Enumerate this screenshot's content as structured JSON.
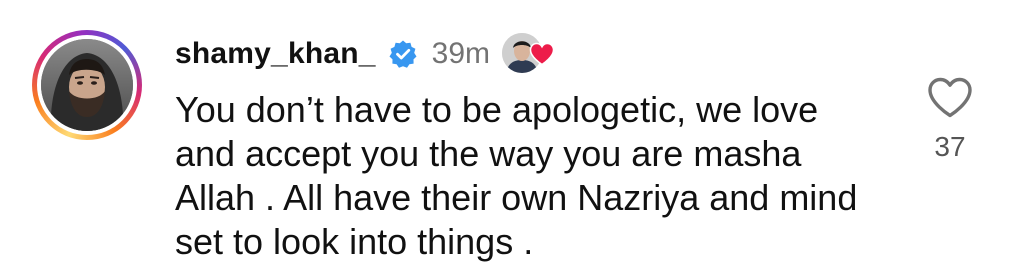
{
  "comment": {
    "username": "shamy_khan_",
    "verified": true,
    "timestamp": "39m",
    "text": "You don’t have to be apologetic, we love and accept you the way you are masha Allah . All have their own Nazriya and mind set to look into things .",
    "like_count": "37",
    "liked_by_author": true
  },
  "icons": {
    "verified": "verified-badge-icon",
    "like": "heart-outline-icon",
    "author_like": "heart-filled-icon"
  },
  "colors": {
    "verified_blue": "#3897f0",
    "heart_red": "#ed1c4a",
    "timestamp_gray": "#737373"
  }
}
